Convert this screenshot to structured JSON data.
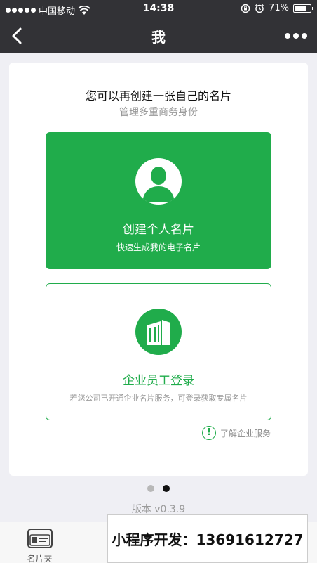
{
  "status_bar": {
    "carrier": "中国移动",
    "time": "14:38",
    "battery": "71%",
    "battery_level": 0.71
  },
  "nav": {
    "title": "我"
  },
  "panel": {
    "headline": "您可以再创建一张自己的名片",
    "subline": "管理多重商务身份",
    "personal": {
      "title": "创建个人名片",
      "desc": "快速生成我的电子名片"
    },
    "enterprise": {
      "title": "企业员工登录",
      "desc": "若您公司已开通企业名片服务，可登录获取专属名片"
    },
    "learn_more": "了解企业服务",
    "info_glyph": "!"
  },
  "pager": {
    "count": 2,
    "active": 2
  },
  "version": "版本 v0.3.9",
  "tabs": [
    {
      "label": "名片夹",
      "icon": "card-holder-icon"
    }
  ],
  "promo": "小程序开发：13691612727",
  "colors": {
    "accent": "#20ac4b",
    "nav_bg": "#323236",
    "page_bg": "#efeff4"
  }
}
